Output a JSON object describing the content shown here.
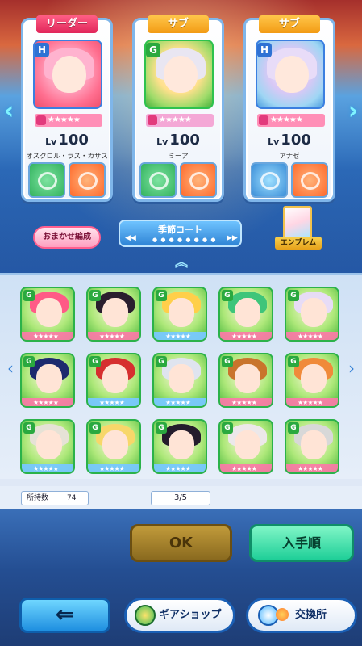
{
  "party": [
    {
      "role": "リーダー",
      "type": "H",
      "level_prefix": "Lv",
      "level": "100",
      "name": "オスクロル・ラス・カサス",
      "stars": "★★★★★"
    },
    {
      "role": "サブ",
      "type": "G",
      "level_prefix": "Lv",
      "level": "100",
      "name": "ミーア",
      "stars": "★★★★★"
    },
    {
      "role": "サブ",
      "type": "H",
      "level_prefix": "Lv",
      "level": "100",
      "name": "アナゼ",
      "stars": "★★★★★"
    }
  ],
  "controls": {
    "omakase": "おまかせ編成",
    "court": "季節コート",
    "court_dots": "● ● ● ● ● ● ● ●",
    "emblem": "エンブレム",
    "prev_arrow": "‹",
    "next_arrow": "›",
    "court_prev": "◀◀",
    "court_next": "▶▶",
    "collapse": "︽"
  },
  "roster": {
    "type_label": "G",
    "stars": "★★★★★",
    "prev": "‹",
    "next": "›"
  },
  "counts": {
    "owned_label": "所持数",
    "owned_value": "74",
    "page": "3/5"
  },
  "buttons": {
    "ok": "OK",
    "order": "入手順",
    "back": "⇐",
    "gear_shop": "ギアショップ",
    "exchange": "交換所"
  }
}
